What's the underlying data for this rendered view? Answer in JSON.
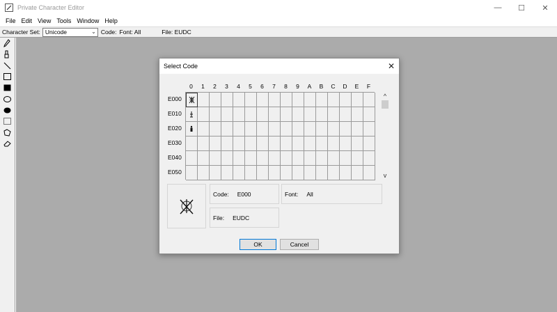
{
  "window": {
    "title": "Private Character Editor",
    "minimize_glyph": "—",
    "maximize_glyph": "☐",
    "close_glyph": "✕"
  },
  "menu": [
    "File",
    "Edit",
    "View",
    "Tools",
    "Window",
    "Help"
  ],
  "infobar": {
    "charset_label": "Character Set:",
    "charset_value": "Unicode",
    "code_label": "Code:",
    "font_label": "Font: All",
    "file_label": "File: EUDC"
  },
  "toolbar": {
    "tools": [
      "pencil-icon",
      "brush-icon",
      "line-icon",
      "hollow-rectangle-icon",
      "filled-rectangle-icon",
      "hollow-ellipse-icon",
      "filled-ellipse-icon",
      "rectangular-selection-icon",
      "freeform-selection-icon",
      "eraser-icon"
    ]
  },
  "dialog": {
    "title": "Select Code",
    "close_glyph": "✕",
    "columns": [
      "0",
      "1",
      "2",
      "3",
      "4",
      "5",
      "6",
      "7",
      "8",
      "9",
      "A",
      "B",
      "C",
      "D",
      "E",
      "F"
    ],
    "rows": [
      "E000",
      "E010",
      "E020",
      "E030",
      "E040",
      "E050"
    ],
    "selected_cell": "E000",
    "scroll_up_glyph": "^",
    "scroll_down_glyph": "v",
    "code_label": "Code:",
    "code_value": "E000",
    "font_label": "Font:",
    "font_value": "All",
    "file_label": "File:",
    "file_value": "EUDC",
    "ok_label": "OK",
    "cancel_label": "Cancel"
  }
}
